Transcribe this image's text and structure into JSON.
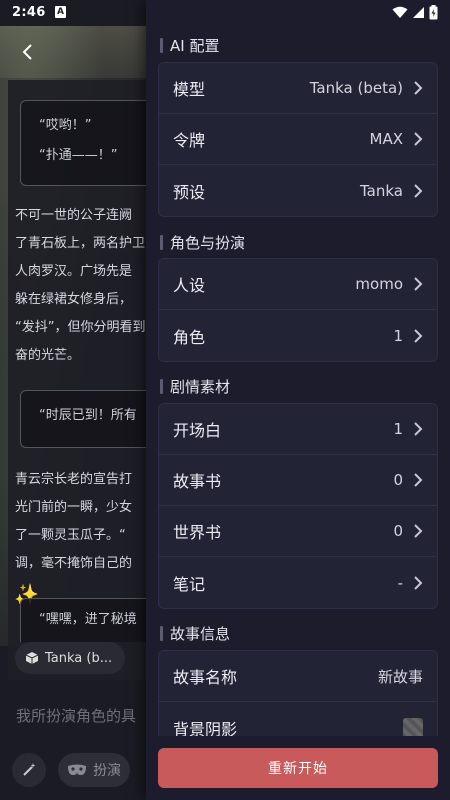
{
  "status_bar": {
    "time": "2:46",
    "notif_letter": "A"
  },
  "background": {
    "quotes": [
      {
        "lines": [
          "“哎哟！”",
          "“扑通——！”"
        ]
      },
      {
        "lines": [
          "“时辰已到！所有"
        ]
      },
      {
        "lines": [
          "“嘿嘿，进了秘境"
        ]
      }
    ],
    "paragraph_1": [
      "不可一世的公子连阙",
      "了青石板上，两名护卫",
      "人肉罗汉。广场先是",
      "躲在绿裙女修身后，",
      "“发抖”，但你分明看到",
      "奋的光芒。"
    ],
    "paragraph_2": [
      "青云宗长老的宣告打",
      "光门前的一瞬，少女",
      "了一颗灵玉瓜子。“",
      "调，毫不掩饰自己的"
    ],
    "model_chip": "Tanka (b...",
    "input_placeholder": "我所扮演角色的具",
    "roleplay_button": "扮演"
  },
  "drawer": {
    "sections": [
      {
        "title": "AI 配置",
        "rows": [
          {
            "label": "模型",
            "value": "Tanka (beta)"
          },
          {
            "label": "令牌",
            "value": "MAX"
          },
          {
            "label": "预设",
            "value": "Tanka"
          }
        ]
      },
      {
        "title": "角色与扮演",
        "rows": [
          {
            "label": "人设",
            "value": "momo"
          },
          {
            "label": "角色",
            "value": "1"
          }
        ]
      },
      {
        "title": "剧情素材",
        "rows": [
          {
            "label": "开场白",
            "value": "1"
          },
          {
            "label": "故事书",
            "value": "0"
          },
          {
            "label": "世界书",
            "value": "0"
          },
          {
            "label": "笔记",
            "value": "-"
          }
        ]
      },
      {
        "title": "故事信息",
        "rows": [
          {
            "label": "故事名称",
            "value": "新故事"
          },
          {
            "label": "背景阴影",
            "value": ""
          }
        ]
      }
    ],
    "restart_button": "重新开始"
  }
}
